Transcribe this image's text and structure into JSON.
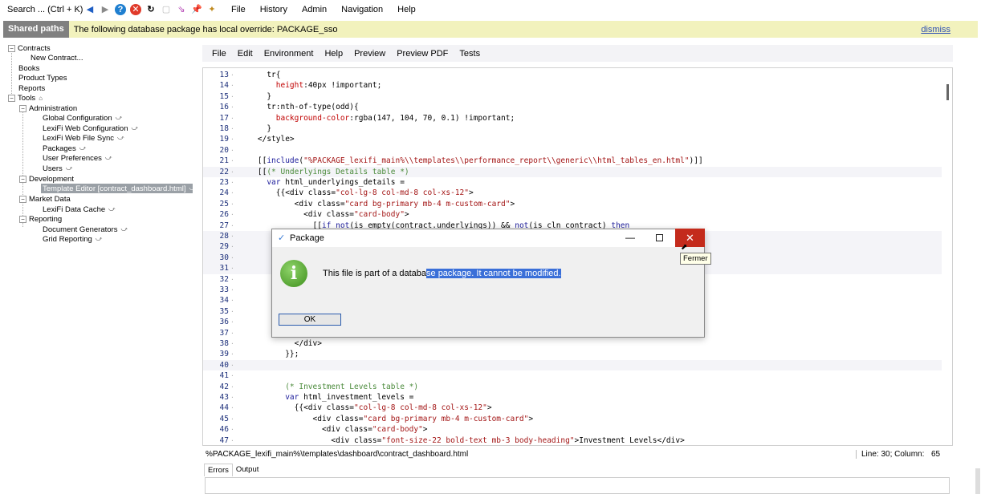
{
  "toolbar": {
    "search": "Search ... (Ctrl + K)",
    "menu": [
      "File",
      "History",
      "Admin",
      "Navigation",
      "Help"
    ]
  },
  "banner": {
    "tag": "Shared paths",
    "message": "The following database package has local override: PACKAGE_sso",
    "dismiss": "dismiss"
  },
  "tree": {
    "contracts": "Contracts",
    "new_contract": "New Contract...",
    "books": "Books",
    "product_types": "Product Types",
    "reports": "Reports",
    "tools": "Tools",
    "administration": "Administration",
    "global_config": "Global Configuration",
    "lexifi_web_config": "LexiFi Web Configuration",
    "lexifi_web_sync": "LexiFi Web File Sync",
    "packages": "Packages",
    "user_prefs": "User Preferences",
    "users": "Users",
    "development": "Development",
    "template_editor": "Template Editor [contract_dashboard.html]",
    "market_data": "Market Data",
    "lexifi_cache": "LexiFi Data Cache",
    "reporting": "Reporting",
    "doc_generators": "Document Generators",
    "grid_reporting": "Grid Reporting"
  },
  "editor_menu": [
    "File",
    "Edit",
    "Environment",
    "Help",
    "Preview",
    "Preview PDF",
    "Tests"
  ],
  "code": [
    {
      "n": "13",
      "t": "      tr{"
    },
    {
      "n": "14",
      "t": "        height:40px !important;"
    },
    {
      "n": "15",
      "t": "      }"
    },
    {
      "n": "16",
      "t": "      tr:nth-of-type(odd){"
    },
    {
      "n": "17",
      "t": "        background-color:rgba(147, 104, 70, 0.1) !important;"
    },
    {
      "n": "18",
      "t": "      }"
    },
    {
      "n": "19",
      "t": "    </style>"
    },
    {
      "n": "20",
      "t": ""
    },
    {
      "n": "21",
      "t": "    [[include(\"%PACKAGE_lexifi_main%\\\\templates\\\\performance_report\\\\generic\\\\html_tables_en.html\")]]"
    },
    {
      "n": "22",
      "t": "    [[(* Underlyings Details table *)"
    },
    {
      "n": "23",
      "t": "      var html_underlyings_details ="
    },
    {
      "n": "24",
      "t": "        {{<div class=\"col-lg-8 col-md-8 col-xs-12\">"
    },
    {
      "n": "25",
      "t": "            <div class=\"card bg-primary mb-4 m-custom-card\">"
    },
    {
      "n": "26",
      "t": "              <div class=\"card-body\">"
    },
    {
      "n": "27",
      "t": "                [[if not(is_empty(contract.underlyings)) && not(is_cln_contract) then"
    },
    {
      "n": "28",
      "t": ""
    },
    {
      "n": "29",
      "t": ""
    },
    {
      "n": "30",
      "t": ""
    },
    {
      "n": "31",
      "t": ""
    },
    {
      "n": "32",
      "t": ""
    },
    {
      "n": "33",
      "t": ""
    },
    {
      "n": "34",
      "t": ""
    },
    {
      "n": "35",
      "t": ""
    },
    {
      "n": "36",
      "t": ""
    },
    {
      "n": "37",
      "t": ""
    },
    {
      "n": "38",
      "t": "            </div>"
    },
    {
      "n": "39",
      "t": "          }};"
    },
    {
      "n": "40",
      "t": ""
    },
    {
      "n": "41",
      "t": ""
    },
    {
      "n": "42",
      "t": "          (* Investment Levels table *)"
    },
    {
      "n": "43",
      "t": "          var html_investment_levels ="
    },
    {
      "n": "44",
      "t": "            {{<div class=\"col-lg-8 col-md-8 col-xs-12\">"
    },
    {
      "n": "45",
      "t": "                <div class=\"card bg-primary mb-4 m-custom-card\">"
    },
    {
      "n": "46",
      "t": "                  <div class=\"card-body\">"
    },
    {
      "n": "47",
      "t": "                    <div class=\"font-size-22 bold-text mb-3 body-heading\">Investment Levels</div>"
    }
  ],
  "status": {
    "path": "%PACKAGE_lexifi_main%\\templates\\dashboard\\contract_dashboard.html",
    "position": "Line:  30; Column:",
    "column": "65"
  },
  "bottom_tabs": [
    "Errors",
    "Output"
  ],
  "dialog": {
    "title": "Package",
    "message_plain": "This file is part of a databa",
    "message_selected": "se package. It cannot be modified.",
    "ok": "OK",
    "tooltip": "Fermer"
  },
  "colors": {
    "banner_bg": "#f2f2bd",
    "close_red": "#c42b1c",
    "selection_blue": "#3a6fd8"
  }
}
